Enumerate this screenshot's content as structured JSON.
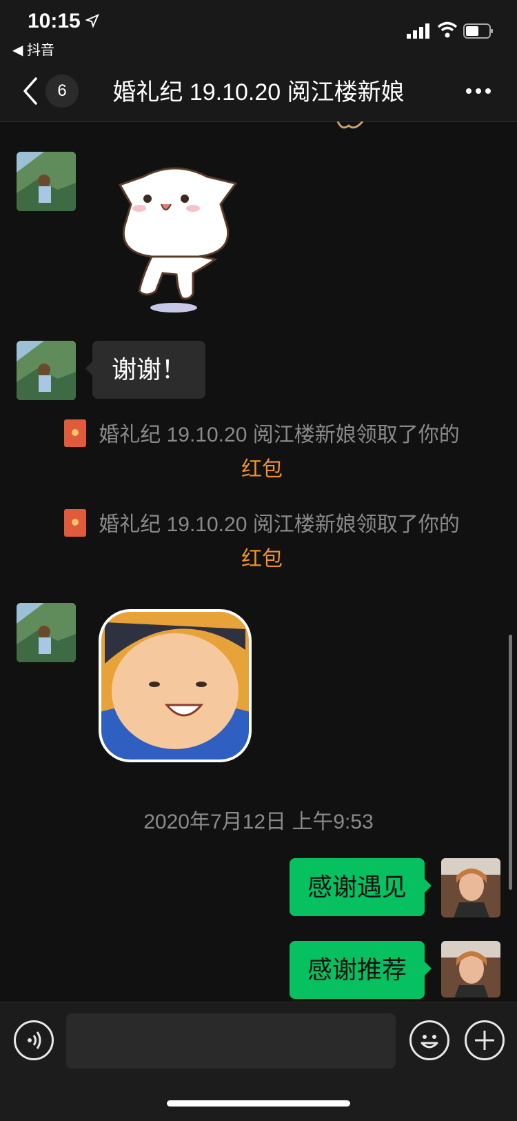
{
  "status_bar": {
    "time": "10:15",
    "back_app": "◀ 抖音",
    "icons": [
      "location-arrow-icon",
      "signal-icon",
      "wifi-icon",
      "battery-icon"
    ]
  },
  "nav": {
    "unread_count": "6",
    "title": "婚礼纪 19.10.20 阅江楼新娘"
  },
  "messages": {
    "thanks_text": "谢谢！",
    "red_packet_1": {
      "text": "婚礼纪 19.10.20 阅江楼新娘领取了你的",
      "link": "红包"
    },
    "red_packet_2": {
      "text": "婚礼纪 19.10.20 阅江楼新娘领取了你的",
      "link": "红包"
    },
    "timestamp": "2020年7月12日 上午9:53",
    "out_1": "感谢遇见",
    "out_2": "感谢推荐"
  },
  "input": {
    "placeholder": "",
    "buttons": [
      "voice-icon",
      "emoji-icon",
      "plus-icon"
    ]
  },
  "colors": {
    "background": "#111111",
    "bar": "#191919",
    "bubble_in": "#2c2c2c",
    "bubble_out": "#07c160",
    "link": "#f0932b",
    "red_packet": "#e05a3c"
  }
}
